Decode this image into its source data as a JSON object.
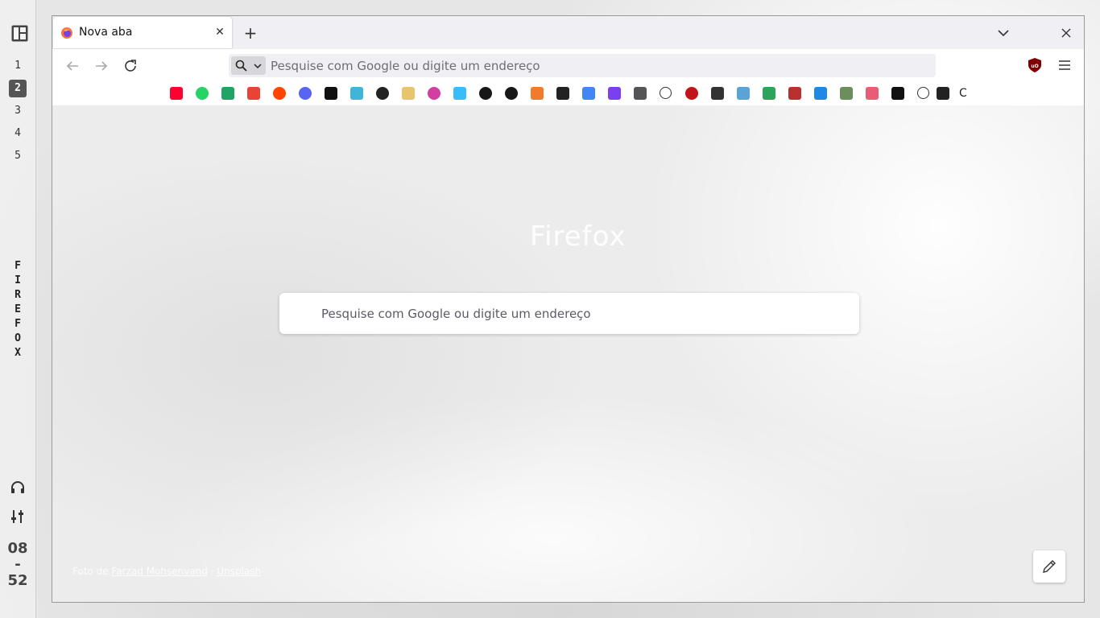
{
  "sidebar": {
    "layout_icon": "layout-grid-icon",
    "workspaces": [
      {
        "label": "1",
        "active": false
      },
      {
        "label": "2",
        "active": true
      },
      {
        "label": "3",
        "active": false
      },
      {
        "label": "4",
        "active": false
      },
      {
        "label": "5",
        "active": false
      }
    ],
    "window_title_letters": [
      "F",
      "I",
      "R",
      "E",
      "F",
      "O",
      "X"
    ],
    "bottom_icons": [
      "headphones-icon",
      "sliders-icon"
    ],
    "clock": {
      "hours": "08",
      "separator": "-",
      "minutes": "52"
    }
  },
  "browser": {
    "tab": {
      "title": "Nova aba",
      "favicon": "firefox-icon"
    },
    "new_tab_label": "+",
    "close_tab_label": "✕",
    "urlbar": {
      "placeholder": "Pesquise com Google ou digite um endereço",
      "value": ""
    },
    "bookmarks": [
      {
        "name": "youtube-icon",
        "color": "#ff0033"
      },
      {
        "name": "whatsapp-icon",
        "color": "#25d366"
      },
      {
        "name": "google-drive-icon",
        "color": "#1fa463"
      },
      {
        "name": "gmail-icon",
        "color": "#ea4335"
      },
      {
        "name": "reddit-icon",
        "color": "#ff4500"
      },
      {
        "name": "discord-icon",
        "color": "#5865f2"
      },
      {
        "name": "bookmark-r-icon",
        "color": "#111111"
      },
      {
        "name": "diamond-icon",
        "color": "#3fb6d9"
      },
      {
        "name": "rust-icon",
        "color": "#222222"
      },
      {
        "name": "mascot-icon",
        "color": "#e8c56a"
      },
      {
        "name": "react-icon",
        "color": "#d13fa0"
      },
      {
        "name": "tailwind-icon",
        "color": "#38bdf8"
      },
      {
        "name": "github-icon",
        "color": "#181717"
      },
      {
        "name": "github-icon-2",
        "color": "#181717"
      },
      {
        "name": "crab-icon",
        "color": "#f07b2a"
      },
      {
        "name": "notebook-icon",
        "color": "#222222"
      },
      {
        "name": "google-translate-icon",
        "color": "#4285f4"
      },
      {
        "name": "p-logo-icon",
        "color": "#7b3ff2"
      },
      {
        "name": "rs-icon",
        "color": "#555555"
      },
      {
        "name": "globe-icon",
        "color": "#333333"
      },
      {
        "name": "gh-circle-icon",
        "color": "#c4121a"
      },
      {
        "name": "c-terminal-icon",
        "color": "#333333"
      },
      {
        "name": "map-pin-icon",
        "color": "#5aa3d6"
      },
      {
        "name": "layers-icon",
        "color": "#2ea35a"
      },
      {
        "name": "shield-crest-icon",
        "color": "#b8312f"
      },
      {
        "name": "c-logo-icon",
        "color": "#1e88e5"
      },
      {
        "name": "avatar-icon",
        "color": "#6b8e5a"
      },
      {
        "name": "puzzle-icon",
        "color": "#e85d75"
      },
      {
        "name": "notion-icon",
        "color": "#111111"
      },
      {
        "name": "globe-icon-2",
        "color": "#333333"
      },
      {
        "name": "notebook-icon-2",
        "color": "#222222"
      }
    ],
    "bookmark_trailing_text": "C",
    "newtab": {
      "logo_text": "Firefox",
      "search_placeholder": "Pesquise com Google ou digite um endereço",
      "credit_prefix": "Foto de",
      "credit_author": "Farzad Mohsenvand",
      "credit_source": "Unsplash"
    }
  }
}
